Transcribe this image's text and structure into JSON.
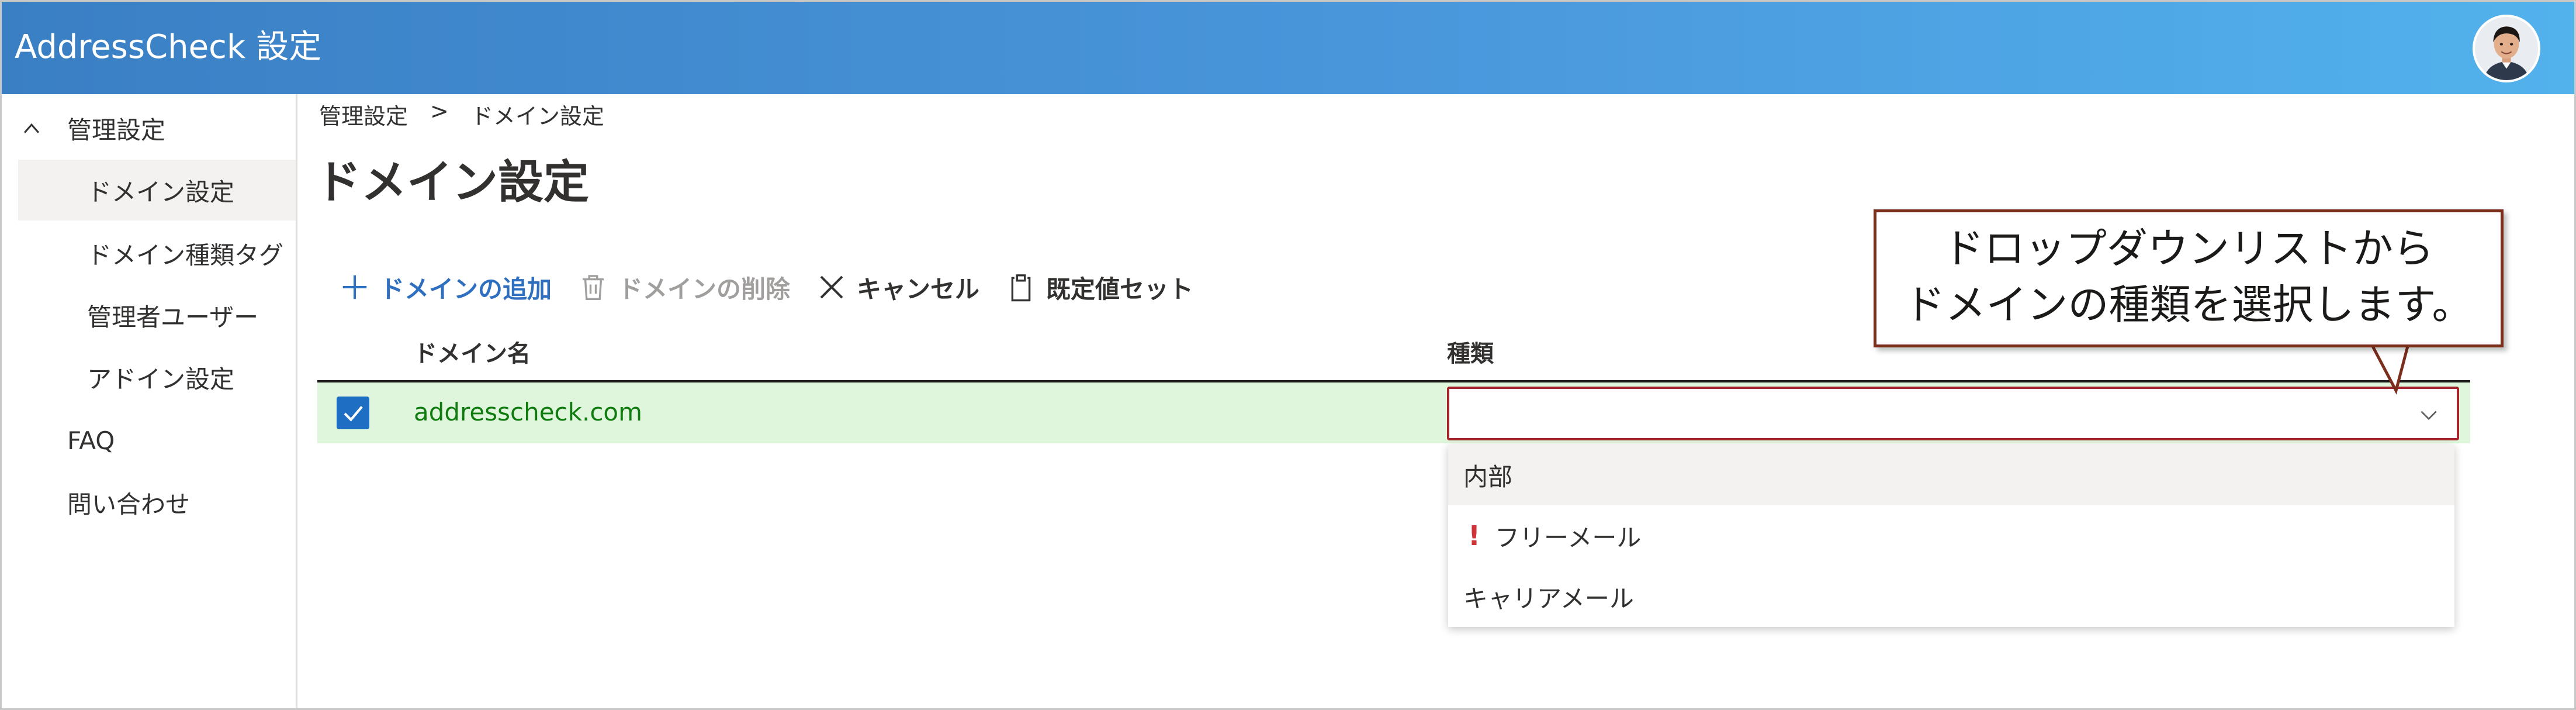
{
  "header": {
    "app_title": "AddressCheck 設定"
  },
  "sidebar": {
    "items": [
      {
        "label": "管理設定",
        "expanded": true
      },
      {
        "label": "ドメイン設定",
        "selected": true
      },
      {
        "label": "ドメイン種類タグ"
      },
      {
        "label": "管理者ユーザー"
      },
      {
        "label": "アドイン設定"
      },
      {
        "label": "FAQ"
      },
      {
        "label": "問い合わせ"
      }
    ]
  },
  "breadcrumb": {
    "root": "管理設定",
    "separator": ">",
    "current": "ドメイン設定"
  },
  "page": {
    "title": "ドメイン設定"
  },
  "toolbar": {
    "add_label": "ドメインの追加",
    "delete_label": "ドメインの削除",
    "cancel_label": "キャンセル",
    "default_label": "既定値セット"
  },
  "table": {
    "columns": [
      "ドメイン名",
      "種類"
    ],
    "rows": [
      {
        "checked": true,
        "domain": "addresscheck.com",
        "type": ""
      }
    ]
  },
  "dropdown": {
    "options": [
      {
        "label": "内部"
      },
      {
        "label": "フリーメール",
        "warning": "!"
      },
      {
        "label": "キャリアメール"
      }
    ]
  },
  "callout": {
    "line1": "ドロップダウンリストから",
    "line2": "ドメインの種類を選択します。"
  },
  "colors": {
    "header_start": "#3a7fc4",
    "header_end": "#52b2ec",
    "accent": "#2f6fc0",
    "row_selected": "#dff6dd",
    "domain_text": "#107c10",
    "dropdown_error_border": "#a4262c",
    "warning": "#d13438",
    "callout_border": "#7b2e1c"
  }
}
